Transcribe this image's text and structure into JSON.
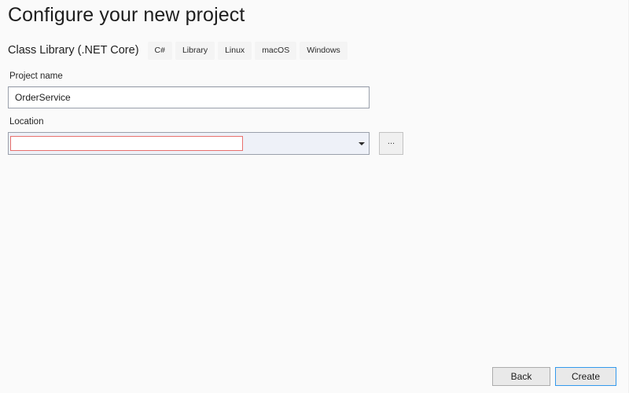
{
  "dialog": {
    "title": "Configure your new project",
    "template_name": "Class Library (.NET Core)",
    "tags": [
      {
        "label": "C#"
      },
      {
        "label": "Library"
      },
      {
        "label": "Linux"
      },
      {
        "label": "macOS"
      },
      {
        "label": "Windows"
      }
    ]
  },
  "fields": {
    "project_name": {
      "label": "Project name",
      "value": "OrderService",
      "placeholder": ""
    },
    "location": {
      "label": "Location",
      "value": "",
      "placeholder": "",
      "dropdown_icon": "chevron-down-icon",
      "browse_label": "...",
      "validation_error": true
    }
  },
  "footer": {
    "back_label": "Back",
    "create_label": "Create"
  },
  "colors": {
    "page_background": "#fafafa",
    "accent": "#3399ec",
    "error_border": "#e8706e",
    "input_border": "#9aa0ab",
    "combo_background": "#eef1f8",
    "chip_background": "#f4f4f4",
    "text": "#1b1b1b"
  }
}
